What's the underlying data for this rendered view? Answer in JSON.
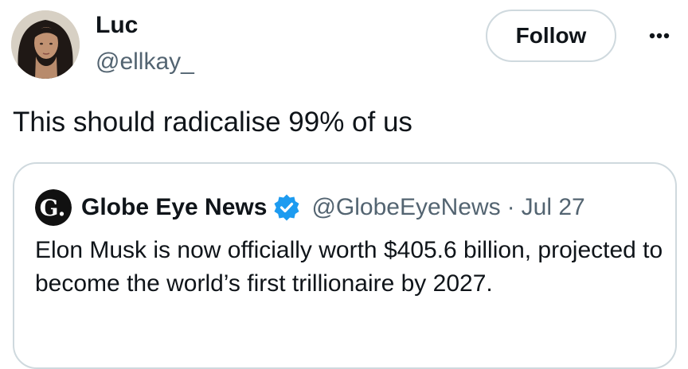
{
  "tweet": {
    "author_name": "Luc",
    "author_handle": "@ellkay_",
    "follow_label": "Follow",
    "text": "This should radicalise 99% of us"
  },
  "quoted": {
    "avatar_letter": "G.",
    "name": "Globe Eye News",
    "handle": "@GlobeEyeNews",
    "separator": "·",
    "date": "Jul 27",
    "text": "Elon Musk is now officially worth $405.6 billion, projected to become the world’s first trillionaire by 2027."
  },
  "icons": {
    "more": "more-horizontal-icon",
    "verified": "verified-badge-icon"
  },
  "colors": {
    "text_primary": "#0f1419",
    "text_secondary": "#536471",
    "border": "#cfd9de",
    "verified_blue": "#1d9bf0"
  }
}
